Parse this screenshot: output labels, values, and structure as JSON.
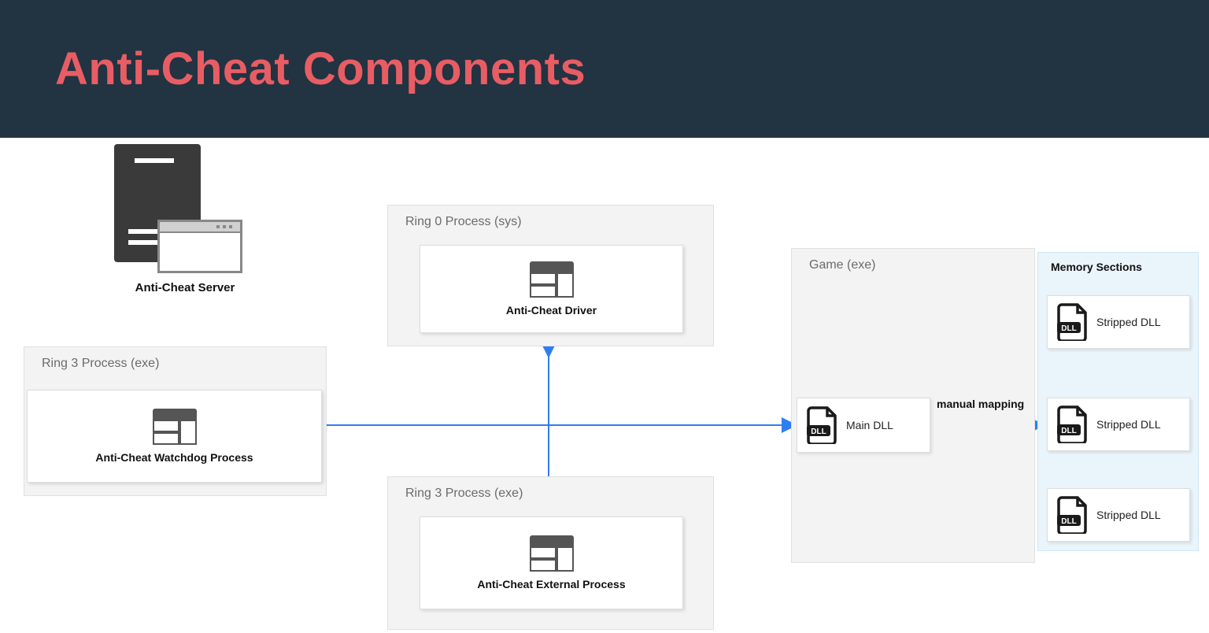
{
  "header": {
    "title": "Anti-Cheat Components"
  },
  "server": {
    "label": "Anti-Cheat Server"
  },
  "groups": {
    "ring0": {
      "title": "Ring 0 Process (sys)",
      "node": "Anti-Cheat Driver"
    },
    "ring3_left": {
      "title": "Ring 3 Process (exe)",
      "node": "Anti-Cheat Watchdog Process"
    },
    "ring3_bottom": {
      "title": "Ring 3 Process (exe)",
      "node": "Anti-Cheat External Process"
    },
    "game": {
      "title": "Game (exe)",
      "node": "Main DLL"
    }
  },
  "memory": {
    "title": "Memory Sections",
    "items": [
      "Stripped DLL",
      "Stripped DLL",
      "Stripped DLL"
    ]
  },
  "labels": {
    "manual_mapping": "manual mapping"
  },
  "colors": {
    "arrow": "#2f7ef0"
  }
}
